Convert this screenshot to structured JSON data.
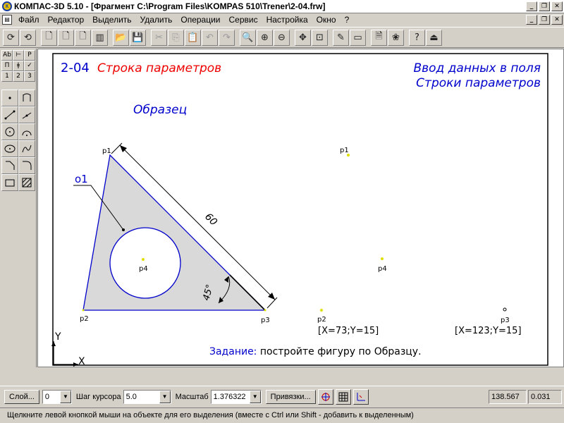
{
  "window": {
    "app_logo": "К",
    "title": "КОМПАС-3D 5.10 - [Фрагмент C:\\Program Files\\KOMPAS 510\\Trener\\2-04.frw]",
    "minimize": "_",
    "restore": "❐",
    "close": "✕"
  },
  "menu": {
    "doc_icon": "▤",
    "items": [
      "Файл",
      "Редактор",
      "Выделить",
      "Удалить",
      "Операции",
      "Сервис",
      "Настройка",
      "Окно",
      "?"
    ]
  },
  "toolbar": {
    "icons": [
      "rebuild-icon",
      "rebuild-all-icon",
      "new-document-icon",
      "new-sheet-icon",
      "new-fragment-icon",
      "new-spec-icon",
      "open-folder-icon",
      "save-icon",
      "cut-icon",
      "copy-icon",
      "paste-icon",
      "undo-icon",
      "redo-icon",
      "zoom-icon",
      "zoom-in-icon",
      "zoom-out-icon",
      "pan-icon",
      "fit-icon",
      "pen-icon",
      "window-icon",
      "preview-icon",
      "library-icon",
      "help-icon",
      "exit-icon"
    ],
    "glyphs": [
      "⟳",
      "⟲",
      "🗋",
      "🗋",
      "🗋",
      "▥",
      "📂",
      "💾",
      "✂",
      "⎘",
      "📋",
      "↶",
      "↷",
      "🔍",
      "⊕",
      "⊖",
      "✥",
      "⊡",
      "✎",
      "▭",
      "🗎",
      "❀",
      "?",
      "⏏"
    ],
    "disabled": [
      false,
      false,
      false,
      false,
      false,
      false,
      false,
      false,
      true,
      true,
      true,
      true,
      true,
      false,
      false,
      false,
      false,
      false,
      false,
      false,
      false,
      false,
      false,
      false
    ]
  },
  "left_panel": {
    "mini_labels": [
      "Ab",
      "⊢",
      "P",
      "П",
      "ǂ",
      "✓",
      "1",
      "2",
      "3"
    ]
  },
  "drawing": {
    "heading_id": "2-04",
    "heading_title": "Строка параметров",
    "subtitle_line1": "Ввод данных в поля",
    "subtitle_line2": "Строки параметров",
    "sample_label": "Образец",
    "callout_label": "о1",
    "dimension_60": "60",
    "dimension_angle": "45°",
    "points": {
      "p1": "p1",
      "p2": "p2",
      "p3": "p3",
      "p4": "p4"
    },
    "coord_p2": "[X=73;Y=15]",
    "coord_p3": "[X=123;Y=15]",
    "axis_x": "X",
    "axis_y": "Y",
    "task_label": "Задание:",
    "task_text": "постройте фигуру по Образцу.",
    "colors": {
      "red": "#ee0000",
      "blue": "#0000cc",
      "fill": "#d9d9d9",
      "point": "#e0e000"
    }
  },
  "status": {
    "layer_button": "Слой...",
    "layer_value": "0",
    "cursor_step_label": "Шаг курсора",
    "cursor_step_value": "5.0",
    "scale_label": "Масштаб",
    "scale_value": "1.376322",
    "snaps_button": "Привязки...",
    "coord_x": "138.567",
    "coord_y": "0.031",
    "hint": "Щелкните левой кнопкой мыши на объекте для его выделения (вместе с Ctrl или Shift - добавить к выделенным)"
  }
}
